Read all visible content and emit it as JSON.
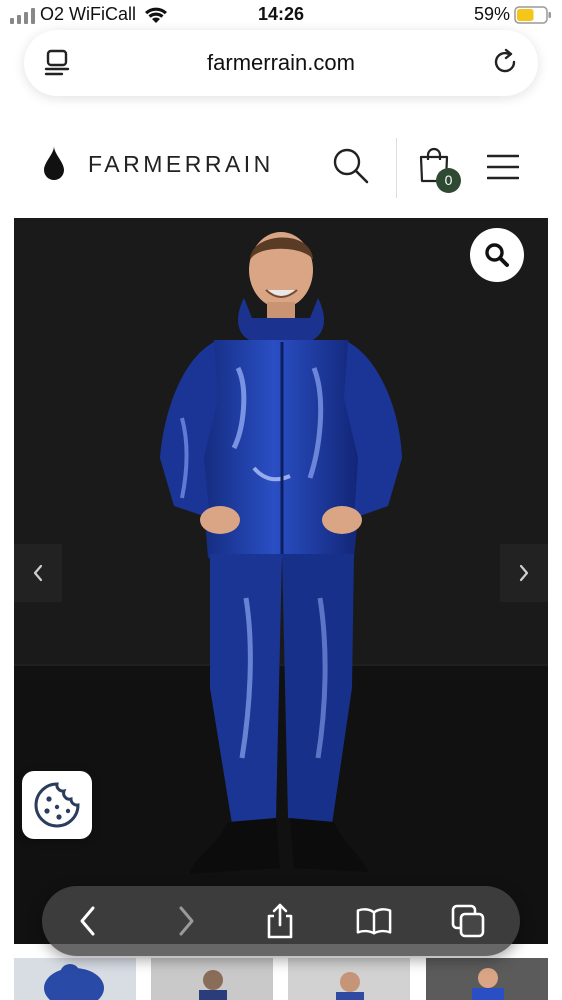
{
  "status_bar": {
    "carrier": "O2 WiFiCall",
    "time": "14:26",
    "battery_percent": "59%",
    "battery_level": 0.59,
    "battery_color": "#f5c518"
  },
  "browser": {
    "url": "farmerrain.com",
    "icons": [
      "reader-icon",
      "reload-icon"
    ]
  },
  "site": {
    "brand": "FARMERRAIN",
    "cart_count": "0",
    "colors": {
      "cart_badge": "#2f4a33",
      "suit": "#1c3a9a"
    },
    "icons": [
      "raindrop-logo-icon",
      "search-icon",
      "shopping-bag-icon",
      "hamburger-menu-icon"
    ]
  },
  "gallery": {
    "icons": [
      "zoom-icon",
      "chevron-left-icon",
      "chevron-right-icon"
    ],
    "thumbnail_count": 4
  },
  "cookie": {
    "icon": "cookie-icon"
  },
  "toolbar": {
    "icons": [
      "back-icon",
      "forward-icon",
      "share-icon",
      "bookmarks-icon",
      "tabs-icon"
    ]
  }
}
